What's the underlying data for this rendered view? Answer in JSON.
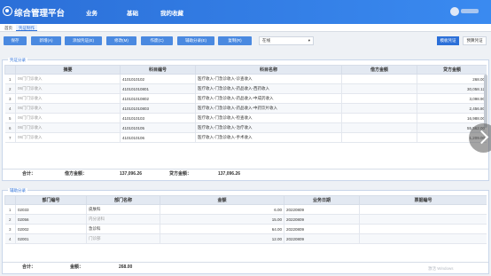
{
  "app": {
    "title": "综合管理平台"
  },
  "nav": {
    "items": [
      "业务",
      "基础",
      "我的收藏"
    ]
  },
  "tabs": [
    "首页",
    "凭证制作"
  ],
  "toolbar": {
    "buttons": [
      "保存",
      "新增(A)",
      "添加凭证(E)",
      "修改(M)",
      "作废(C)",
      "辅助分录(E)",
      "复制(R)"
    ],
    "account_select": "在线",
    "right_buttons": [
      "模板凭证",
      "预算凭证"
    ]
  },
  "entries": {
    "title": "凭证分录",
    "headers": [
      "",
      "摘要",
      "科目编号",
      "科目名称",
      "借方金额",
      "贷方金额"
    ],
    "rows": [
      {
        "idx": "1",
        "summary": "06门门诊收入",
        "code": "4101010102",
        "name": "医疗收入-门急诊收入-诊查收入",
        "debit": "",
        "credit": "268.00"
      },
      {
        "idx": "2",
        "summary": "06门门诊收入",
        "code": "410101010801",
        "name": "医疗收入-门急诊收入-药品收入-西药收入",
        "debit": "",
        "credit": "30,058.12"
      },
      {
        "idx": "3",
        "summary": "06门门诊收入",
        "code": "410101010802",
        "name": "医疗收入-门急诊收入-药品收入-中成药收入",
        "debit": "",
        "credit": "3,098.90"
      },
      {
        "idx": "4",
        "summary": "06门门诊收入",
        "code": "410101010803",
        "name": "医疗收入-门急诊收入-药品收入-中药饮片收入",
        "debit": "",
        "credit": "2,456.80"
      },
      {
        "idx": "5",
        "summary": "06门门诊收入",
        "code": "4101010103",
        "name": "医疗收入-门急诊收入-检查收入",
        "debit": "",
        "credit": "16,988.00"
      },
      {
        "idx": "6",
        "summary": "06门门诊收入",
        "code": "4101010105",
        "name": "医疗收入-门急诊收入-治疗收入",
        "debit": "",
        "credit": "55,562.00"
      },
      {
        "idx": "7",
        "summary": "06门门诊收入",
        "code": "4101010106",
        "name": "医疗收入-门急诊收入-手术收入",
        "debit": "",
        "credit": "1,209.00"
      }
    ],
    "total_label": "合计：",
    "debit_label": "借方金额：",
    "debit_total": "137,096.26",
    "credit_label": "贷方金额：",
    "credit_total": "137,096.26"
  },
  "aux": {
    "title": "辅助分录",
    "headers": [
      "",
      "部门编号",
      "部门名称",
      "金额",
      "业务日期",
      "票据编号"
    ],
    "rows": [
      {
        "idx": "1",
        "code": "02033",
        "name": "皮肤科",
        "amount": "6.00",
        "date": "20220809",
        "bill": ""
      },
      {
        "idx": "2",
        "code": "02056",
        "name": "内分泌科",
        "amount": "15.00",
        "date": "20220809",
        "bill": ""
      },
      {
        "idx": "3",
        "code": "02002",
        "name": "急诊科",
        "amount": "64.00",
        "date": "20220809",
        "bill": ""
      },
      {
        "idx": "4",
        "code": "02001",
        "name": "门诊部",
        "amount": "12.00",
        "date": "20220809",
        "bill": ""
      }
    ],
    "total_label": "合计：",
    "amount_label": "金额：",
    "amount_total": "268.00"
  },
  "watermark": "激活 Windows",
  "colors": {
    "brand": "#2b6fd8",
    "button": "#4a89e0",
    "header_bg": "#e3e9f2"
  },
  "icons": [
    "platform-logo-icon",
    "user-avatar-icon",
    "chevron-right-icon",
    "dropdown-caret-icon"
  ]
}
